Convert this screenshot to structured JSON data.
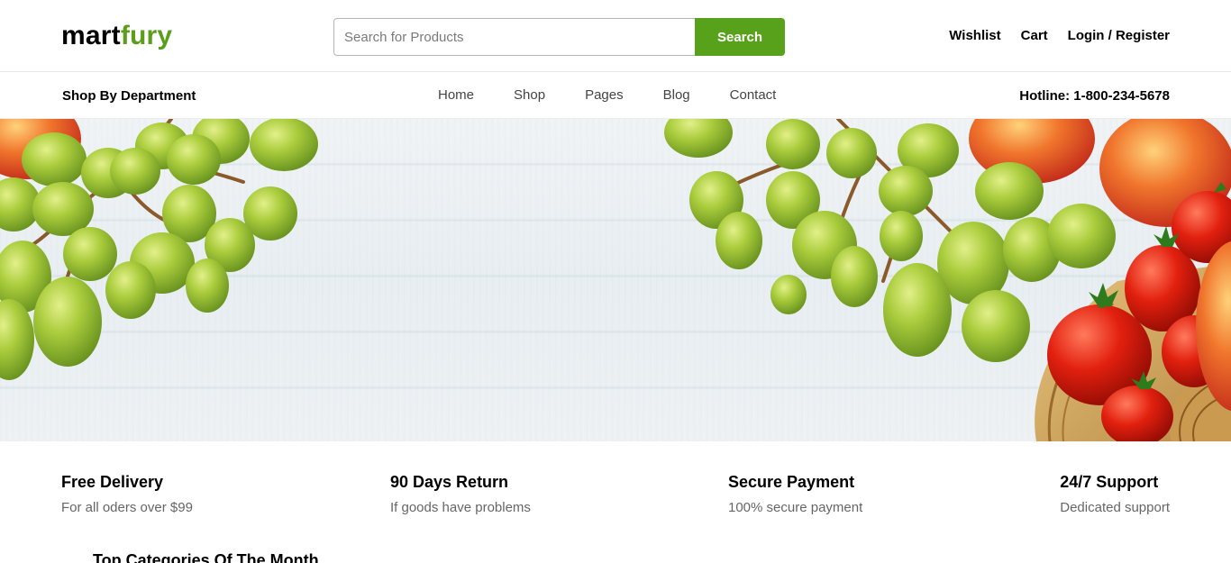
{
  "logo": {
    "part1": "mart",
    "part2": "fury"
  },
  "search": {
    "placeholder": "Search for Products",
    "button_label": "Search"
  },
  "header_links": {
    "wishlist": "Wishlist",
    "cart": "Cart",
    "login": "Login / Register"
  },
  "nav": {
    "department": "Shop By Department",
    "items": [
      {
        "label": "Home"
      },
      {
        "label": "Shop"
      },
      {
        "label": "Pages"
      },
      {
        "label": "Blog"
      },
      {
        "label": "Contact"
      }
    ],
    "hotline": "Hotline: 1-800-234-5678"
  },
  "features": [
    {
      "title": "Free Delivery",
      "desc": "For all oders over $99"
    },
    {
      "title": "90 Days Return",
      "desc": "If goods have problems"
    },
    {
      "title": "Secure Payment",
      "desc": "100% secure payment"
    },
    {
      "title": "24/7 Support",
      "desc": "Dedicated support"
    }
  ],
  "section": {
    "title": "Top Categories Of The Month"
  },
  "colors": {
    "brand_green": "#58a21b",
    "logo_green": "#5b9e1a"
  }
}
